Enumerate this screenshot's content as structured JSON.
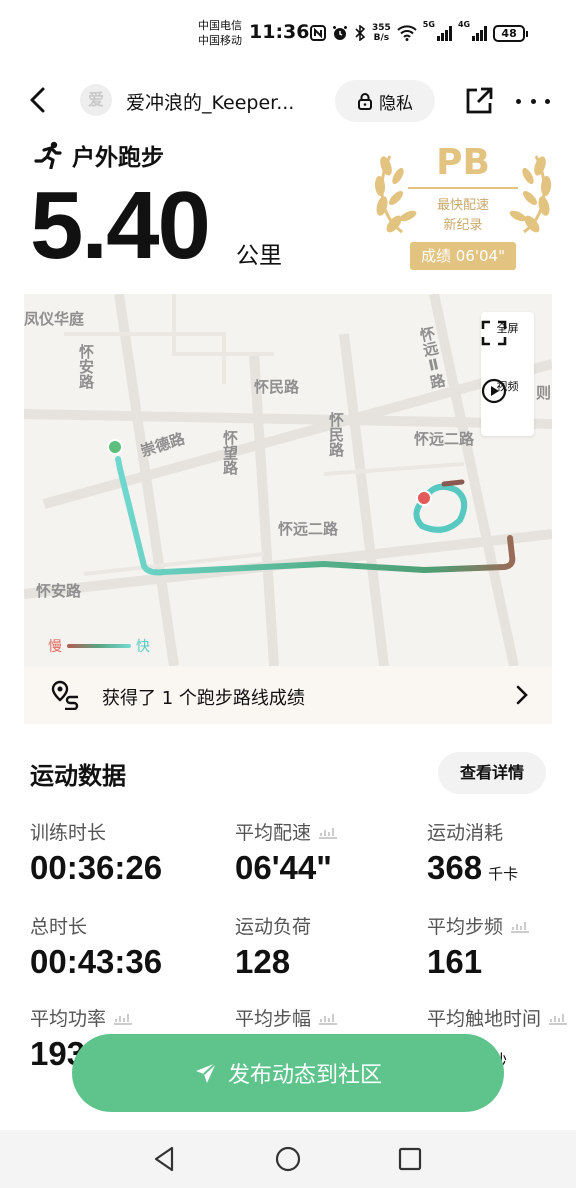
{
  "status_bar": {
    "carrier_1": "中国电信",
    "carrier_2": "中国移动",
    "time": "11:36",
    "net_speed_value": "355",
    "net_speed_unit": "B/s",
    "net_tag_1": "5G",
    "net_tag_2": "4G",
    "battery": "48",
    "icons": [
      "nfc-icon",
      "alarm-icon",
      "bluetooth-icon",
      "wifi-icon",
      "signal-icon",
      "battery-icon"
    ]
  },
  "header": {
    "avatar_text": "爱",
    "user_name": "爱冲浪的_Keeper...",
    "privacy_label": "隐私",
    "icons": [
      "back-icon",
      "lock-icon",
      "share-icon",
      "more-icon"
    ]
  },
  "workout": {
    "type_label": "户外跑步",
    "distance": "5.40",
    "distance_unit": "公里"
  },
  "pb_badge": {
    "title": "PB",
    "line_1": "最快配速",
    "line_2": "新纪录",
    "score": "成绩 06'04\"",
    "color": "#e3c380"
  },
  "map": {
    "labels": {
      "l1": "凤仪华庭",
      "l2": "怀安路",
      "l3": "怀民路",
      "l4": "怀远Ⅱ路",
      "l5": "崇德路",
      "l6": "怀望路",
      "l7": "怀民路",
      "l8": "怀远二路",
      "l9": "怀远二路",
      "l10": "怀安路",
      "l11": "则"
    },
    "controls": {
      "fullscreen_label": "全屏",
      "video_label": "视频"
    },
    "legend": {
      "slow": "慢",
      "fast": "快"
    },
    "colors": {
      "slow": "#e06a60",
      "fast": "#57c9c1",
      "start": "#5cbf7c",
      "end": "#e35a5a"
    }
  },
  "route_achievement": {
    "text": "获得了 1 个跑步路线成绩"
  },
  "sports_data": {
    "title": "运动数据",
    "details_button": "查看详情",
    "metrics": [
      {
        "label": "训练时长",
        "value": "00:36:26",
        "unit": ""
      },
      {
        "label": "平均配速",
        "value": "06'44\"",
        "unit": ""
      },
      {
        "label": "运动消耗",
        "value": "368",
        "unit": "千卡"
      },
      {
        "label": "总时长",
        "value": "00:43:36",
        "unit": ""
      },
      {
        "label": "运动负荷",
        "value": "128",
        "unit": ""
      },
      {
        "label": "平均步频",
        "value": "161",
        "unit": ""
      },
      {
        "label": "平均功率",
        "value": "193",
        "unit": ""
      },
      {
        "label": "平均步幅",
        "value": "",
        "unit": ""
      },
      {
        "label": "平均触地时间",
        "value": "",
        "unit": "毫秒"
      }
    ]
  },
  "publish_button": {
    "label": "发布动态到社区",
    "color": "#5ec48c"
  },
  "nav_bar": {
    "icons": [
      "nav-back-icon",
      "nav-home-icon",
      "nav-recents-icon"
    ]
  }
}
